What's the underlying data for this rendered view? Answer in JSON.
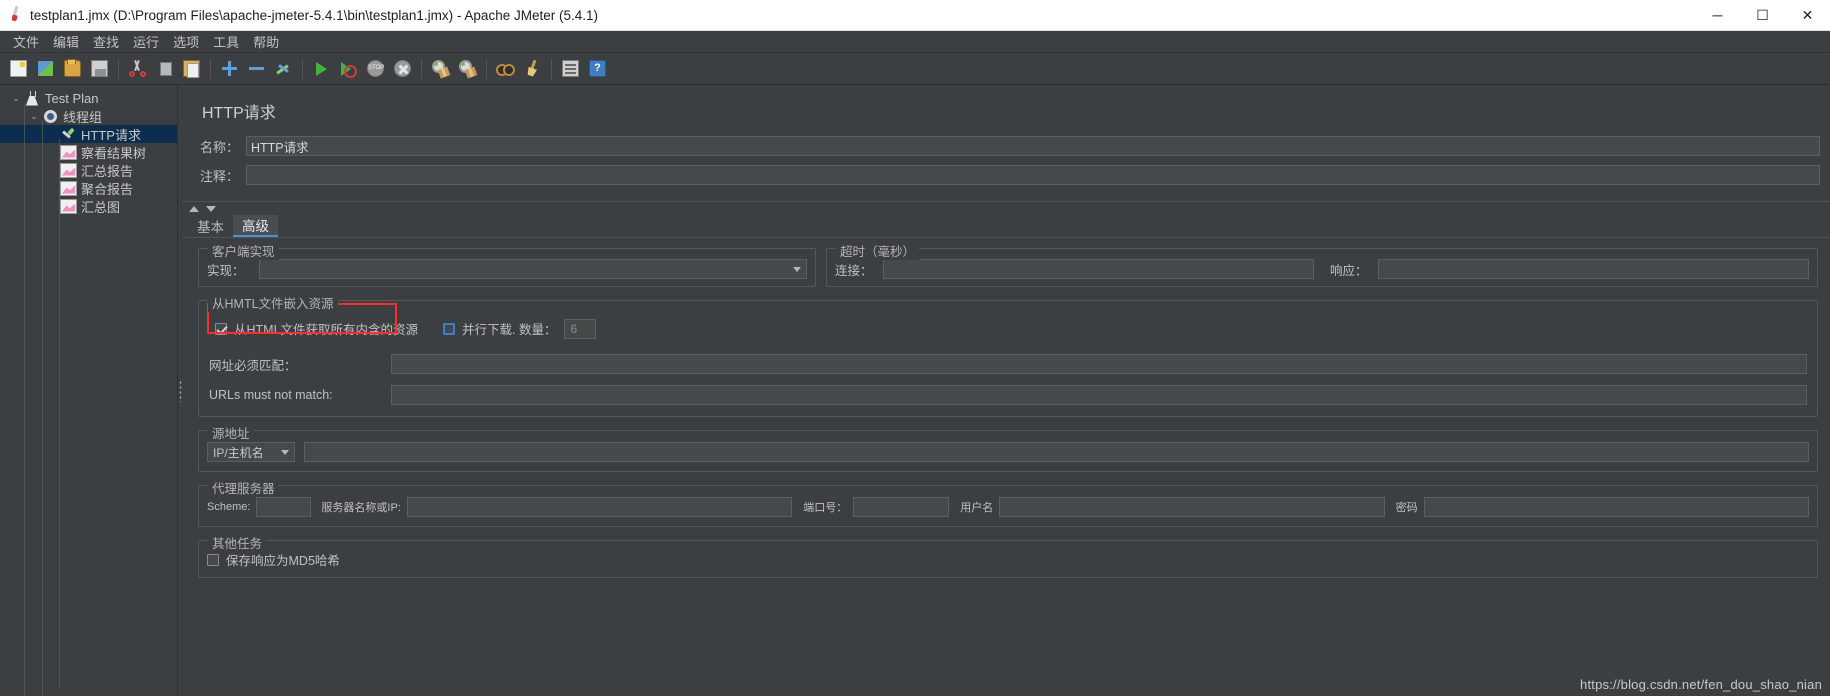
{
  "window": {
    "title": "testplan1.jmx (D:\\Program Files\\apache-jmeter-5.4.1\\bin\\testplan1.jmx) - Apache JMeter (5.4.1)",
    "app_icon": "jmeter-feather-icon",
    "minimize": "─",
    "maximize": "☐",
    "close": "✕"
  },
  "menu": {
    "items": [
      {
        "label": "文件"
      },
      {
        "label": "编辑"
      },
      {
        "label": "查找"
      },
      {
        "label": "运行"
      },
      {
        "label": "选项"
      },
      {
        "label": "工具"
      },
      {
        "label": "帮助"
      }
    ]
  },
  "toolbar": {
    "buttons": [
      {
        "name": "new-icon",
        "icon": "new"
      },
      {
        "name": "templates-icon",
        "icon": "templates"
      },
      {
        "name": "open-icon",
        "icon": "open"
      },
      {
        "name": "save-icon",
        "icon": "save"
      },
      {
        "name": "cut-icon",
        "icon": "cut"
      },
      {
        "name": "copy-icon",
        "icon": "copy"
      },
      {
        "name": "paste-icon",
        "icon": "paste"
      },
      {
        "name": "expand-all-icon",
        "icon": "plus"
      },
      {
        "name": "collapse-all-icon",
        "icon": "minus"
      },
      {
        "name": "toggle-icon",
        "icon": "toggle"
      },
      {
        "name": "start-icon",
        "icon": "play"
      },
      {
        "name": "start-no-pauses-icon",
        "icon": "playno"
      },
      {
        "name": "stop-icon",
        "icon": "stop",
        "text": "STOP"
      },
      {
        "name": "shutdown-icon",
        "icon": "shut"
      },
      {
        "name": "clear-icon",
        "icon": "clear"
      },
      {
        "name": "clear-all-icon",
        "icon": "clear"
      },
      {
        "name": "search-icon",
        "icon": "search"
      },
      {
        "name": "reset-search-icon",
        "icon": "broom"
      },
      {
        "name": "function-helper-icon",
        "icon": "fn"
      },
      {
        "name": "help-icon",
        "icon": "help",
        "text": "?"
      }
    ]
  },
  "tree": {
    "nodes": [
      {
        "label": "Test Plan",
        "icon": "flask-icon",
        "depth": 0,
        "toggle": "⌄",
        "selected": false
      },
      {
        "label": "线程组",
        "icon": "gear-icon",
        "depth": 1,
        "toggle": "⌄",
        "selected": false
      },
      {
        "label": "HTTP请求",
        "icon": "pipette-icon",
        "depth": 2,
        "toggle": "",
        "selected": true
      },
      {
        "label": "察看结果树",
        "icon": "chart-icon",
        "depth": 2,
        "toggle": "",
        "selected": false
      },
      {
        "label": "汇总报告",
        "icon": "chart-icon",
        "depth": 2,
        "toggle": "",
        "selected": false
      },
      {
        "label": "聚合报告",
        "icon": "chart-icon",
        "depth": 2,
        "toggle": "",
        "selected": false
      },
      {
        "label": "汇总图",
        "icon": "chart-icon",
        "depth": 2,
        "toggle": "",
        "selected": false
      }
    ]
  },
  "main": {
    "title": "HTTP请求",
    "name_label": "名称：",
    "name_value": "HTTP请求",
    "comment_label": "注释：",
    "comment_value": "",
    "tabs": [
      {
        "label": "基本",
        "active": false
      },
      {
        "label": "高级",
        "active": true
      }
    ],
    "client_impl": {
      "title": "客户端实现",
      "impl_label": "实现：",
      "impl_value": ""
    },
    "timeouts": {
      "title": "超时（毫秒）",
      "connect_label": "连接：",
      "connect_value": "",
      "response_label": "响应：",
      "response_value": ""
    },
    "embedded": {
      "title": "从HMTL文件嵌入资源",
      "retrieve_label": "从HTML文件获取所有内含的资源",
      "retrieve_checked": true,
      "parallel_label": "并行下载. 数量：",
      "parallel_checked": false,
      "parallel_value": "6",
      "url_must_match_label": "网址必须匹配：",
      "url_must_match_value": "",
      "url_must_not_match_label": "URLs must not match:",
      "url_must_not_match_value": "",
      "highlight_color": "#ff2d2d"
    },
    "source_address": {
      "title": "源地址",
      "type_value": "IP/主机名",
      "address_value": ""
    },
    "proxy": {
      "title": "代理服务器",
      "scheme_label": "Scheme:",
      "scheme_value": "",
      "host_label": "服务器名称或IP:",
      "host_value": "",
      "port_label": "端口号：",
      "port_value": "",
      "username_label": "用户名",
      "username_value": "",
      "password_label": "密码",
      "password_value": ""
    },
    "other_tasks": {
      "title": "其他任务",
      "md5_label": "保存响应为MD5哈希",
      "md5_checked": false
    }
  },
  "watermark": {
    "text": "https://blog.csdn.net/fen_dou_shao_nian"
  }
}
